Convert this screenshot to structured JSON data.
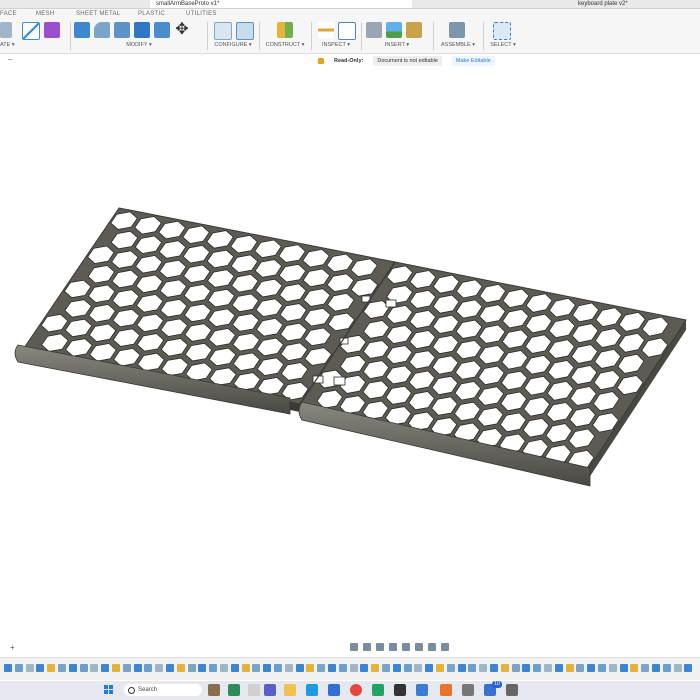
{
  "window": {
    "active_tab_title": "smallArmBaseProto v1*",
    "other_tab_title": "keyboard plate v2*"
  },
  "workspace_tabs": [
    "FACE",
    "MESH",
    "SHEET METAL",
    "PLASTIC",
    "UTILITIES"
  ],
  "ribbon_groups": [
    {
      "label": "ATE ▾",
      "icons": [
        "sketch-icon",
        "box-icon"
      ]
    },
    {
      "label": "",
      "icons": [
        "sketch-line-icon",
        "form-icon"
      ]
    },
    {
      "label": "MODIFY ▾",
      "icons": [
        "press-pull-icon",
        "fillet-icon",
        "shell-icon",
        "combine-icon",
        "align-icon",
        "move-icon"
      ]
    },
    {
      "label": "CONFIGURE ▾",
      "icons": [
        "configure-table-icon",
        "configure-rule-icon"
      ]
    },
    {
      "label": "CONSTRUCT ▾",
      "icons": [
        "offset-plane-icon"
      ]
    },
    {
      "label": "INSPECT ▾",
      "icons": [
        "measure-icon",
        "section-analysis-icon"
      ]
    },
    {
      "label": "INSERT ▾",
      "icons": [
        "insert-derive-icon",
        "insert-image-icon",
        "insert-mesh-icon"
      ]
    },
    {
      "label": "ASSEMBLE ▾",
      "icons": [
        "new-component-icon"
      ]
    },
    {
      "label": "SELECT ▾",
      "icons": [
        "select-icon"
      ]
    }
  ],
  "readonly_bar": {
    "label": "Read-Only:",
    "note": "Document is not editable",
    "action": "Make Editable"
  },
  "taskbar": {
    "search_placeholder": "Search",
    "notification_count": "10"
  },
  "colors": {
    "accent": "#1a7fd4",
    "plate": "#5e5b55",
    "plate_edge": "#3c3a36"
  }
}
